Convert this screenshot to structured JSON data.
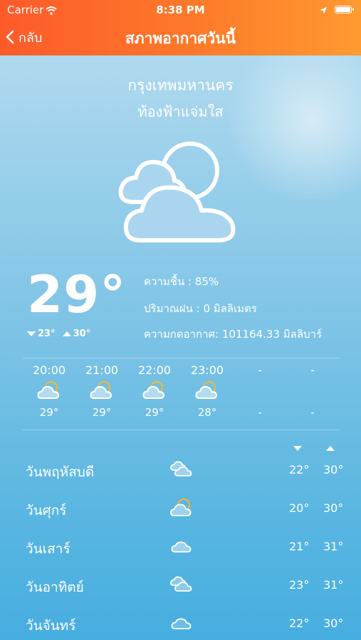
{
  "status_bar": {
    "carrier": "Carrier",
    "time": "8:38 PM"
  },
  "nav": {
    "back_label": "กลับ",
    "title": "สภาพอากาศวันนี้"
  },
  "location": {
    "city": "กรุงเทพมหานคร",
    "condition": "ท้องฟ้าแจ่มใส"
  },
  "current": {
    "temperature": "29°",
    "min": "23°",
    "max": "30°",
    "humidity": "ความชื้น : 85%",
    "rainfall": "ปริมาณฝน : 0 มิลลิเมตร",
    "pressure": "ความกดอากาศ: 101164.33 มิลลิบาร์",
    "icon": "cloud-sun-icon"
  },
  "hourly": [
    {
      "time": "20:00",
      "temp": "29°",
      "icon": "cloud-sun-icon"
    },
    {
      "time": "21:00",
      "temp": "29°",
      "icon": "cloud-sun-icon"
    },
    {
      "time": "22:00",
      "temp": "29°",
      "icon": "cloud-sun-icon"
    },
    {
      "time": "23:00",
      "temp": "28°",
      "icon": "cloud-sun-icon"
    },
    {
      "time": "-",
      "temp": "-"
    },
    {
      "time": "-",
      "temp": "-"
    }
  ],
  "daily": [
    {
      "day": "วันพฤหัสบดี",
      "low": "22°",
      "high": "30°",
      "icon": "clouds-icon"
    },
    {
      "day": "วันศุกร์",
      "low": "20°",
      "high": "30°",
      "icon": "cloud-sun-icon"
    },
    {
      "day": "วันเสาร์",
      "low": "21°",
      "high": "31°",
      "icon": "cloud-icon"
    },
    {
      "day": "วันอาทิตย์",
      "low": "23°",
      "high": "31°",
      "icon": "clouds-icon"
    },
    {
      "day": "วันจันทร์",
      "low": "22°",
      "high": "30°",
      "icon": "cloud-icon"
    }
  ],
  "colors": {
    "header_start": "#fd5a2a",
    "header_end": "#ff9a30",
    "sun": "#f5b82e"
  }
}
